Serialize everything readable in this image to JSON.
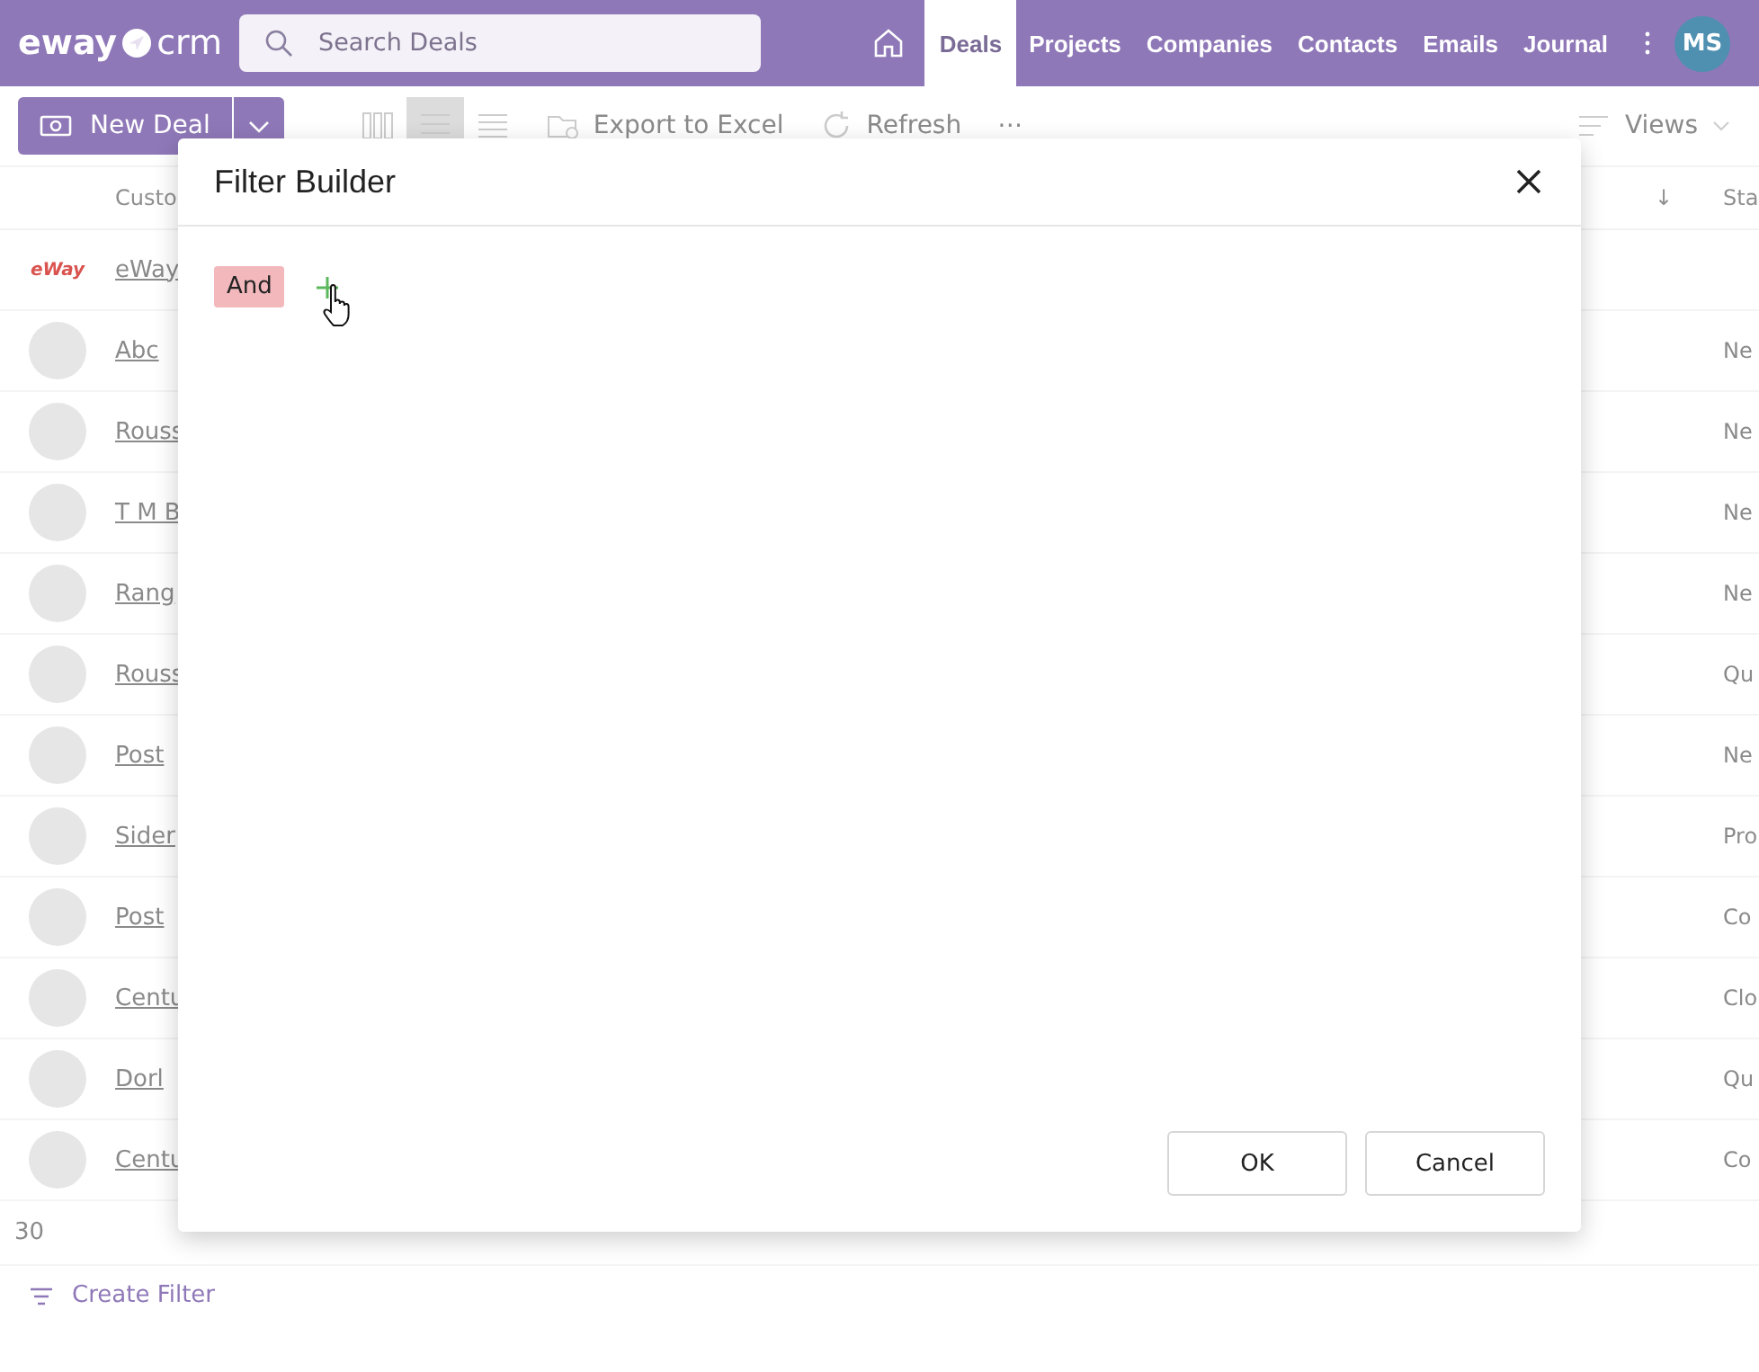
{
  "header": {
    "logo": {
      "left": "eway",
      "right": "crm"
    },
    "search": {
      "placeholder": "Search Deals"
    },
    "tabs": [
      {
        "label": "Deals",
        "selected": true
      },
      {
        "label": "Projects",
        "selected": false
      },
      {
        "label": "Companies",
        "selected": false
      },
      {
        "label": "Contacts",
        "selected": false
      },
      {
        "label": "Emails",
        "selected": false
      },
      {
        "label": "Journal",
        "selected": false
      }
    ],
    "user_initials": "MS"
  },
  "toolbar": {
    "new_button": "New Deal",
    "views": [
      {
        "kind": "columns",
        "selected": false
      },
      {
        "kind": "list",
        "selected": true
      },
      {
        "kind": "compact",
        "selected": false
      }
    ],
    "export": "Export to Excel",
    "refresh": "Refresh",
    "more": "⋯",
    "views_menu": "Views"
  },
  "table": {
    "columns": [
      "Custo",
      "↓",
      "Sta"
    ],
    "rows": [
      {
        "kind": "logo",
        "logo_text": "eWay",
        "customer": "eWay",
        "status": ""
      },
      {
        "kind": "photo",
        "customer": "Abc",
        "status": "Ne"
      },
      {
        "kind": "photo",
        "customer": "Rouss",
        "status": "Ne"
      },
      {
        "kind": "photo",
        "customer": "T M B",
        "status": "Ne"
      },
      {
        "kind": "photo",
        "customer": "Rang",
        "status": "Ne"
      },
      {
        "kind": "photo",
        "customer": "Rouss",
        "status": "Qu"
      },
      {
        "kind": "photo",
        "customer": "Post",
        "status": "Ne"
      },
      {
        "kind": "photo",
        "customer": "Sider",
        "status": "Pro"
      },
      {
        "kind": "photo",
        "customer": "Post",
        "status": "Co"
      },
      {
        "kind": "photo",
        "customer": "Centu",
        "status": "Clo"
      },
      {
        "kind": "photo",
        "customer": "Dorl",
        "status": "Qu"
      },
      {
        "kind": "photo",
        "customer": "Centu",
        "status": "Co"
      }
    ],
    "count": "30"
  },
  "footer": {
    "create_filter": "Create Filter"
  },
  "dialog": {
    "title": "Filter Builder",
    "group_operator": "And",
    "buttons": [
      {
        "label": "OK"
      },
      {
        "label": "Cancel"
      }
    ]
  }
}
